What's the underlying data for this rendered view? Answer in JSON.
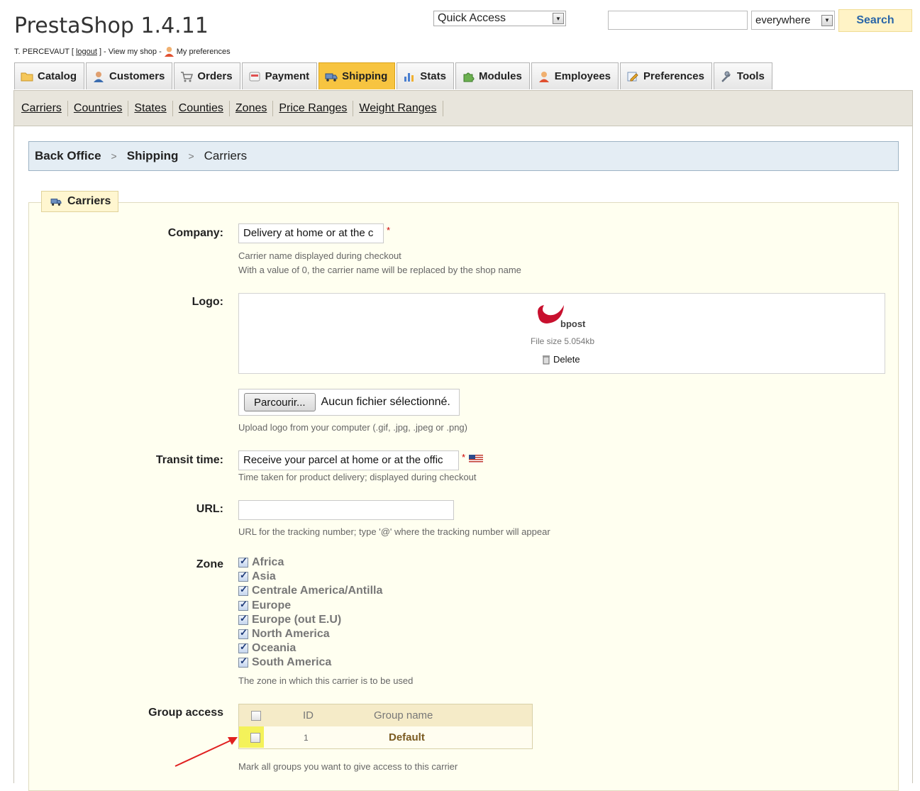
{
  "header": {
    "shop_title": "PrestaShop 1.4.11",
    "user_prefix": "T. PERCEVAUT [",
    "logout": "logout",
    "user_mid": "] - View my shop -",
    "my_preferences": "My preferences",
    "quick_access": "Quick Access",
    "search_value": "",
    "search_scope": "everywhere",
    "search_button": "Search"
  },
  "tabs": [
    {
      "label": "Catalog",
      "icon": "folder-icon",
      "active": false
    },
    {
      "label": "Customers",
      "icon": "customer-icon",
      "active": false
    },
    {
      "label": "Orders",
      "icon": "cart-icon",
      "active": false
    },
    {
      "label": "Payment",
      "icon": "payment-icon",
      "active": false
    },
    {
      "label": "Shipping",
      "icon": "truck-icon",
      "active": true
    },
    {
      "label": "Stats",
      "icon": "stats-icon",
      "active": false
    },
    {
      "label": "Modules",
      "icon": "puzzle-icon",
      "active": false
    },
    {
      "label": "Employees",
      "icon": "employee-icon",
      "active": false
    },
    {
      "label": "Preferences",
      "icon": "preferences-icon",
      "active": false
    },
    {
      "label": "Tools",
      "icon": "wrench-icon",
      "active": false
    }
  ],
  "subnav": [
    "Carriers",
    "Countries",
    "States",
    "Counties",
    "Zones",
    "Price Ranges",
    "Weight Ranges"
  ],
  "breadcrumb": {
    "root": "Back Office",
    "section": "Shipping",
    "current": "Carriers"
  },
  "form": {
    "legend": "Carriers",
    "company_label": "Company:",
    "company_value": "Delivery at home or at the c",
    "company_help1": "Carrier name displayed during checkout",
    "company_help2": "With a value of 0, the carrier name will be replaced by the shop name",
    "logo_label": "Logo:",
    "logo_brand": "bpost",
    "logo_filesize": "File size 5.054kb",
    "logo_delete": "Delete",
    "browse_button": "Parcourir...",
    "no_file": "Aucun fichier sélectionné.",
    "upload_help": "Upload logo from your computer (.gif, .jpg, .jpeg or .png)",
    "transit_label": "Transit time:",
    "transit_value": "Receive your parcel at home or at the offic",
    "transit_help": "Time taken for product delivery; displayed during checkout",
    "url_label": "URL:",
    "url_value": "",
    "url_help": "URL for the tracking number; type '@' where the tracking number will appear",
    "zone_label": "Zone",
    "zones": [
      "Africa",
      "Asia",
      "Centrale America/Antilla",
      "Europe",
      "Europe (out E.U)",
      "North America",
      "Oceania",
      "South America"
    ],
    "zone_help": "The zone in which this carrier is to be used",
    "group_label": "Group access",
    "group_header_id": "ID",
    "group_header_name": "Group name",
    "group_rows": [
      {
        "id": "1",
        "name": "Default"
      }
    ],
    "group_help": "Mark all groups you want to give access to this carrier",
    "required_mark": "*"
  },
  "colors": {
    "active_tab": "#f7c440",
    "highlight": "#f4f25a",
    "arrow": "#e02020"
  }
}
